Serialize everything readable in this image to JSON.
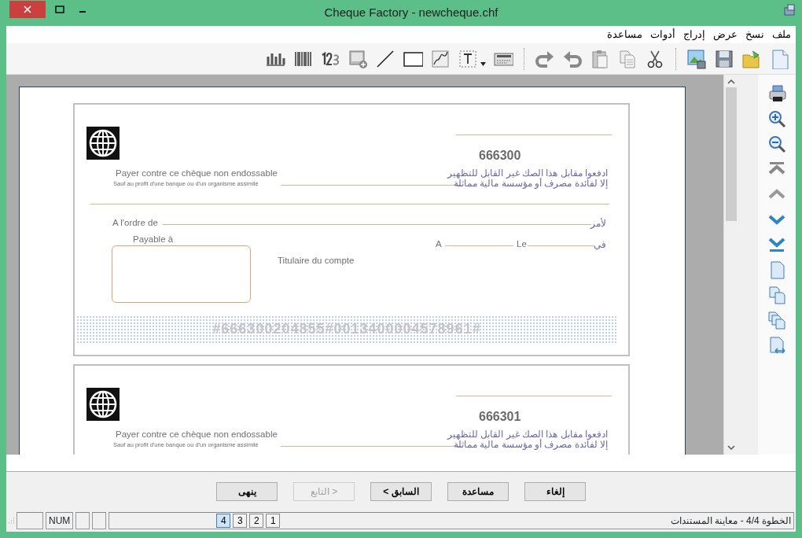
{
  "window": {
    "title": "Cheque Factory - newcheque.chf"
  },
  "menu": [
    "ملف",
    "نسخ",
    "عرض",
    "إدراج",
    "أدوات",
    "مساعدة"
  ],
  "cheques": [
    {
      "number": "666300",
      "fr_line1": "Payer contre ce chèque non endossable",
      "fr_line2": "Sauf au profit d'une banque ou d'un organisme assimilé",
      "ar_line1": "ادفعوا مقابل هذا الصك غير القابل للتظهير",
      "ar_line2": "إلا لفائدة مصرف أو مؤسسة مالية مماثلة",
      "order_fr": "A l'ordre de",
      "order_ar": "لأمر",
      "payable": "Payable à",
      "place": "A",
      "date": "Le",
      "date_ar": "في",
      "holder": "Titulaire du compte",
      "micr": "#666300204855#0013400004578961#"
    },
    {
      "number": "666301",
      "fr_line1": "Payer contre ce chèque non endossable",
      "fr_line2": "Sauf au profit d'une banque ou d'un organisme assimilé",
      "ar_line1": "ادفعوا مقابل هذا الصك غير القابل للتظهير",
      "ar_line2": "إلا لفائدة مصرف أو مؤسسة مالية مماثلة"
    }
  ],
  "buttons": [
    {
      "label": "إلغاء",
      "disabled": false
    },
    {
      "label": "مساعدة",
      "disabled": false
    },
    {
      "label": "< السابق",
      "disabled": false
    },
    {
      "label": "التابع >",
      "disabled": true
    },
    {
      "label": "ينهى",
      "disabled": false
    }
  ],
  "status_bar": {
    "indicator": "NUM",
    "pages": [
      {
        "label": "1",
        "selected": false
      },
      {
        "label": "2",
        "selected": false
      },
      {
        "label": "3",
        "selected": false
      },
      {
        "label": "4",
        "selected": true
      }
    ],
    "step": "الخطوة 4/4 - معاينة المستندات"
  }
}
